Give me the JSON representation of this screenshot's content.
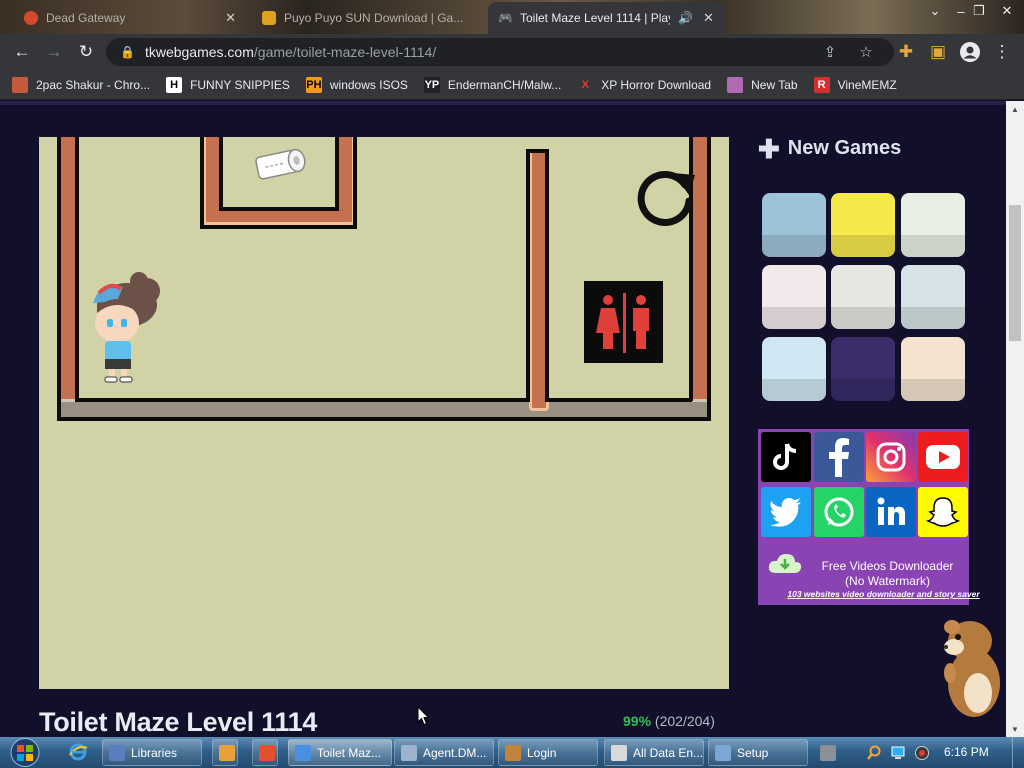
{
  "browser": {
    "tabs": [
      {
        "title": "Dead Gateway",
        "fav_color": "#d24a2a"
      },
      {
        "title": "Puyo Puyo SUN Download | Ga...",
        "fav_color": "#e0a020"
      },
      {
        "title": "Toilet Maze Level 1114 | Play...",
        "fav_color": "#4a7fd8"
      }
    ],
    "url_host": "tkwebgames.com",
    "url_path": "/game/toilet-maze-level-1114/",
    "bookmarks": [
      {
        "label": "2pac Shakur - Chro...",
        "icon": "bookmark-folder-icon",
        "icon_text": "",
        "icon_bg": "#c75a3c",
        "icon_fg": "#fff"
      },
      {
        "label": "FUNNY SNIPPIES",
        "icon": "h-letter-icon",
        "icon_text": "H",
        "icon_bg": "#ffffff",
        "icon_fg": "#000"
      },
      {
        "label": "windows ISOS",
        "icon": "ph-logo-icon",
        "icon_text": "PH",
        "icon_bg": "#f7971d",
        "icon_fg": "#000"
      },
      {
        "label": "EndermanCH/Malw...",
        "icon": "yp-logo-icon",
        "icon_text": "YP",
        "icon_bg": "#202124",
        "icon_fg": "#fff"
      },
      {
        "label": "XP Horror Download",
        "icon": "x-logo-icon",
        "icon_text": "X",
        "icon_bg": "transparent",
        "icon_fg": "#e53935"
      },
      {
        "label": "New Tab",
        "icon": "new-tab-icon",
        "icon_text": "",
        "icon_bg": "#b06ab3",
        "icon_fg": "#fff"
      },
      {
        "label": "VineMEMZ",
        "icon": "r-logo-icon",
        "icon_text": "R",
        "icon_bg": "#d32f2f",
        "icon_fg": "#fff"
      }
    ]
  },
  "page": {
    "game_title": "Toilet Maze Level 1114",
    "rating_percent": "99%",
    "rating_votes": "(202/204)",
    "new_games_heading": "New Games",
    "new_games": [
      {
        "name": "girl-haircut-game",
        "color": "#9cc3d8"
      },
      {
        "name": "grenade-game",
        "color": "#f6e84a"
      },
      {
        "name": "toilet-roll-game",
        "color": "#e8efe4"
      },
      {
        "name": "toilet-maze-red-game",
        "color": "#f4e9ea"
      },
      {
        "name": "draw-line-red-game",
        "color": "#e6e6e2"
      },
      {
        "name": "draw-line-blue-game",
        "color": "#d7e3e6"
      },
      {
        "name": "pixel-runner-game",
        "color": "#cfe6f3"
      },
      {
        "name": "slither-snake-game",
        "color": "#3a2d6a"
      },
      {
        "name": "hang-rope-game",
        "color": "#f3e3cf"
      }
    ],
    "social_ad": {
      "title": "Free Videos Downloader",
      "subtitle": "(No Watermark)",
      "link_text": "103 websites video downloader and story saver"
    }
  },
  "taskbar": {
    "buttons": [
      {
        "label": "Libraries",
        "color": "#5a7fbf"
      },
      {
        "label": "",
        "color": "#e8a13a"
      },
      {
        "label": "",
        "color": "#e2502c"
      },
      {
        "label": "Toilet Maz...",
        "color": "#4a90e2"
      },
      {
        "label": "Agent.DM...",
        "color": "#9db2cc"
      },
      {
        "label": "Login",
        "color": "#c0853a"
      },
      {
        "label": "All Data En...",
        "color": "#d9d9d9"
      },
      {
        "label": "Setup",
        "color": "#7ba7d6"
      }
    ],
    "clock": "6:16 PM"
  },
  "colors": {
    "page_bg": "#120f2b",
    "game_bg": "#d1d2a5",
    "rating_green": "#2fc05a",
    "ad_purple": "#8a43b3"
  }
}
